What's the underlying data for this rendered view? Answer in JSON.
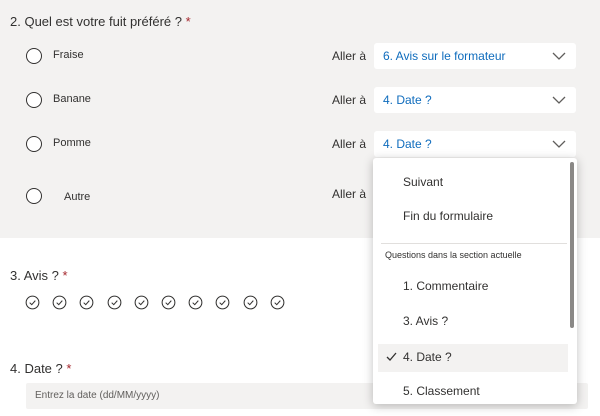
{
  "q2": {
    "title": "2. Quel est votre fuit préféré ?",
    "required": "*",
    "options": [
      {
        "label": "Fraise",
        "goto": "Aller à",
        "select": "6. Avis sur le formateur"
      },
      {
        "label": "Banane",
        "goto": "Aller à",
        "select": "4. Date ?"
      },
      {
        "label": "Pomme",
        "goto": "Aller à",
        "select": "4. Date ?"
      },
      {
        "label": "Autre",
        "goto": "Aller à"
      }
    ]
  },
  "dropdown": {
    "items_top": [
      "Suivant",
      "Fin du formulaire"
    ],
    "section_header": "Questions dans la section actuelle",
    "items": [
      "1. Commentaire",
      "3. Avis ?",
      "4. Date ?",
      "5. Classement"
    ],
    "selected_index": 2
  },
  "q3": {
    "title": "3. Avis ?",
    "required": "*",
    "rating_count": 10,
    "icon": "check-circle-icon"
  },
  "q4": {
    "title": "4. Date ?",
    "required": "*",
    "placeholder": "Entrez la date (dd/MM/yyyy)"
  },
  "colors": {
    "section_bg": "#f3f2f1",
    "accent": "#0f6cbd",
    "required": "#a4262c"
  }
}
